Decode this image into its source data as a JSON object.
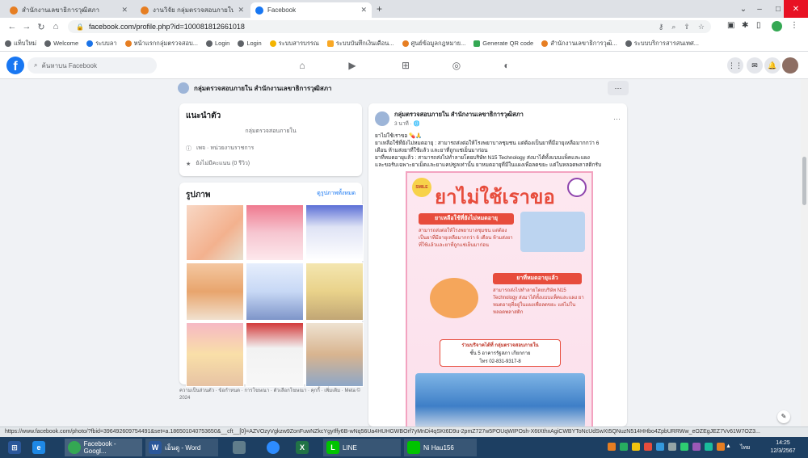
{
  "tabs": [
    {
      "label": "สำนักงานเลขาธิการวุฒิสภา",
      "color": "#e67e22"
    },
    {
      "label": "งานวิจัย กลุ่มตรวจสอบภายใน 2567",
      "color": "#e67e22"
    },
    {
      "label": "Facebook",
      "color": "#1877f2"
    }
  ],
  "new_tab": "+",
  "url": "facebook.com/profile.php?id=100081812661018",
  "bookmarks": [
    {
      "label": "แท็บใหม่",
      "color": "#5f6368"
    },
    {
      "label": "Welcome",
      "color": "#5f6368"
    },
    {
      "label": "ระบบลา",
      "color": "#1a73e8"
    },
    {
      "label": "หน้าแรกกลุ่มตรวจสอบ...",
      "color": "#e67e22"
    },
    {
      "label": "Login",
      "color": "#5f6368"
    },
    {
      "label": "Login",
      "color": "#5f6368"
    },
    {
      "label": "ระบบสารบรรณ",
      "color": "#f4b400"
    },
    {
      "label": "ระบบบันทึกเงินเดือน...",
      "color": "#f9a825"
    },
    {
      "label": "ศูนย์ข้อมูลกฎหมาย...",
      "color": "#e67e22"
    },
    {
      "label": "Generate QR code",
      "color": "#34a853"
    },
    {
      "label": "สำนักงานเลขาธิการวุฒิ...",
      "color": "#e67e22"
    },
    {
      "label": "ระบบบริการสารสนเทศ...",
      "color": "#5f6368"
    }
  ],
  "fb": {
    "search_placeholder": "ค้นหาบน Facebook",
    "page_name": "กลุ่มตรวจสอบภายใน สำนักงานเลขาธิการวุฒิสภา",
    "more": "···"
  },
  "intro": {
    "title": "แนะนำตัว",
    "subtitle": "กลุ่มตรวจสอบภายใน",
    "page_type": "เพจ · หน่วยงานราชการ",
    "rating": "ยังไม่มีคะแนน (0 รีวิว)"
  },
  "photos": {
    "title": "รูปภาพ",
    "see_all": "ดูรูปภาพทั้งหมด"
  },
  "footer": "ความเป็นส่วนตัว · ข้อกำหนด · การโฆษณา · ตัวเลือกโฆษณา · คุกกี้ · เพิ่มเติม · Meta © 2024",
  "post": {
    "author": "กลุ่มตรวจสอบภายใน สำนักงานเลขาธิการวุฒิสภา",
    "time": "3 นาที · 🌐",
    "more": "···",
    "body_1": "ยาไม่ใช้เราขอ 💊🙏",
    "body_2": "ยาเหลือใช้ที่ยังไม่หมดอายุ : สามารถส่งต่อให้โรงพยาบาลชุมชน แต่ต้องเป็นยาที่มีอายุเหลือมากกว่า 6",
    "body_3": "เดือน ห้ามส่งยาที่ใช้แล้ว และยาที่ถูกแช่เย็นมาก่อน",
    "body_4": "ยาที่หมดอายุแล้ว : สามารถส่งไปทำลายโดยบริษัท N15 Technology ส่งมาได้ทั้งแบบแพ็คและแผง",
    "body_5": "และขอรับเฉพาะยาเม็ดและยาแคปซูลเท่านั้น ยาหมดอายุที่มีในแผงเพื่อลดขยะ แต่ในหลอดพลาสติกรับ"
  },
  "poster": {
    "title": "ยาไม่ใช้เราขอ",
    "s1_head": "ยาเหลือใช้ที่ยังไม่หมดอายุ",
    "s1_text": "สามารถส่งต่อให้โรงพยาบาลชุมชน แต่ต้องเป็นยาที่มีอายุเหลือมากกว่า 6 เดือน ห้ามส่งยาที่ใช้แล้วและยาที่ถูกแช่เย็นมาก่อน",
    "s2_head": "ยาที่หมดอายุแล้ว",
    "s2_text": "สามารถส่งไปทำลายโดยบริษัท N15 Technology ส่งมาได้ทั้งแบบแพ็คและแผง ยาหมดอายุที่อยู่ในแผงเพื่อลดขยะ แต่ไม่ในหลอดพลาสติก",
    "contact_1": "ร่วมบริจาคได้ที่ กลุ่มตรวจสอบภายใน",
    "contact_2": "ชั้น 5 อาคารรัฐสภา เกียกกาย",
    "contact_3": "โทร 02-831-9317-8",
    "logo_text": "SMILE"
  },
  "status_url": "https://www.facebook.com/photo/?fbid=396492609754491&set=a.186501040753650&__cft__[0]=AZVOzyVgkzw9ZonFuwNZkcYgyIffy6B-wNq56Ua4HUHGWBOrf7yMnDi4qSKt6D9u-2pmZ727w5POUqWIPOsh-X6tXthxAgiCWBYToNcUdSwXt5QNuzN514HHbo4ZpbURRWw_eOZEgJEZ7Vv61W7OZ3...",
  "taskbar": {
    "chrome": "Facebook - Googl...",
    "word": "เอ็นดู - Word",
    "line": "LINE",
    "user": "Ni Hau156",
    "time": "14:25",
    "date": "12/3/2567",
    "lang": "ไทย"
  }
}
